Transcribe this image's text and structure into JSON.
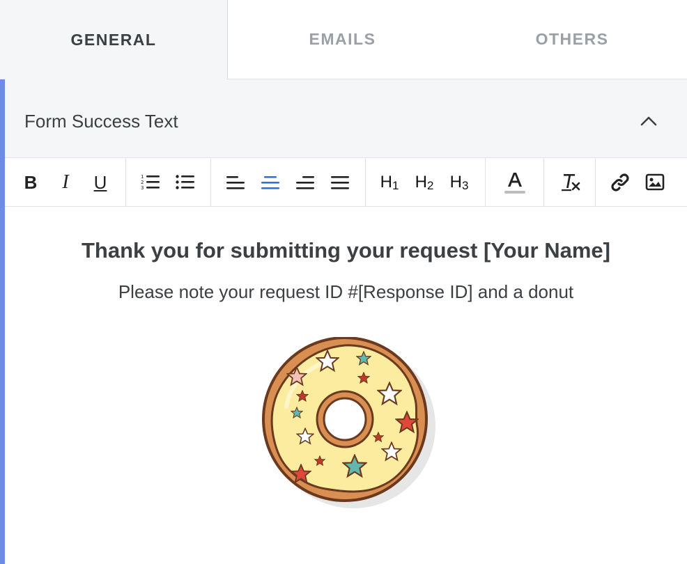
{
  "tabs": [
    {
      "label": "GENERAL",
      "active": true
    },
    {
      "label": "EMAILS",
      "active": false
    },
    {
      "label": "OTHERS",
      "active": false
    }
  ],
  "section": {
    "title": "Form Success Text",
    "collapse_icon": "chevron-up-icon"
  },
  "toolbar": {
    "bold": "B",
    "italic": "I",
    "underline": "U",
    "h1": "H",
    "h1_sub": "1",
    "h2": "H",
    "h2_sub": "2",
    "h3": "H",
    "h3_sub": "3",
    "font_color": "A",
    "active_align": "center"
  },
  "content": {
    "heading": "Thank you for submitting your request [Your Name]",
    "note": "Please note your request ID #[Response ID] and a donut",
    "image": "donut-image"
  },
  "colors": {
    "accent": "#6c8de7",
    "active_tool": "#3a6fd8",
    "text": "#3c4043",
    "muted_tab": "#9aa0a6"
  }
}
